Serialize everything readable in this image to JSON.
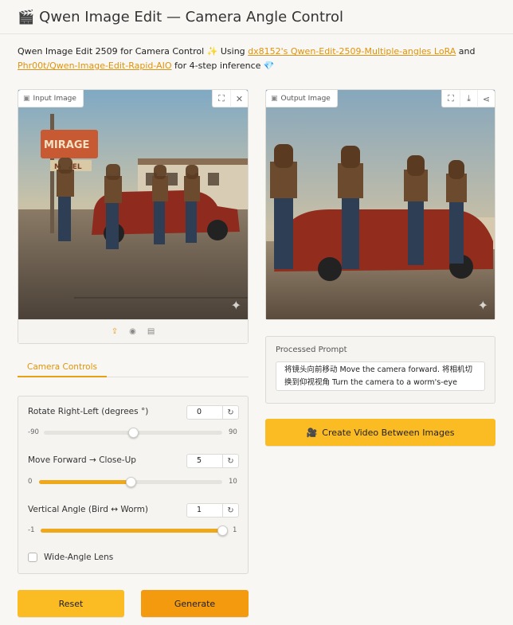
{
  "header": {
    "icon": "clapperboard-icon",
    "title": "Qwen Image Edit — Camera Angle Control"
  },
  "description": {
    "prefix": "Qwen Image Edit 2509 for Camera Control ✨ Using ",
    "link1": "dx8152's Qwen-Edit-2509-Multiple-angles LoRA",
    "middle": " and ",
    "link2": "Phr00t/Qwen-Image-Edit-Rapid-AIO",
    "suffix": " for 4-step inference 💎"
  },
  "input_image": {
    "label": "Input Image",
    "tools": [
      "fullscreen-icon",
      "close-icon"
    ],
    "source_icons": [
      "upload-icon",
      "webcam-icon",
      "clipboard-icon"
    ]
  },
  "output_image": {
    "label": "Output Image",
    "tools": [
      "fullscreen-icon",
      "download-icon",
      "share-icon"
    ]
  },
  "tabs": {
    "active": "Camera Controls"
  },
  "controls": {
    "rotate": {
      "label": "Rotate Right-Left (degrees °)",
      "value": "0",
      "min": "-90",
      "max": "90",
      "fraction": 0.5
    },
    "forward": {
      "label": "Move Forward → Close-Up",
      "value": "5",
      "min": "0",
      "max": "10",
      "fraction": 0.5
    },
    "vertical": {
      "label": "Vertical Angle (Bird ↔ Worm)",
      "value": "1",
      "min": "-1",
      "max": "1",
      "fraction": 1.0
    },
    "wide_angle": {
      "label": "Wide-Angle Lens",
      "checked": false
    }
  },
  "processed_prompt": {
    "label": "Processed Prompt",
    "text": "将镜头向前移动 Move the camera forward. 将相机切换到仰视视角 Turn the camera to a worm's-eye view."
  },
  "buttons": {
    "create_video": "Create Video Between Images",
    "reset": "Reset",
    "generate": "Generate"
  },
  "colors": {
    "accent": "#f0a81b",
    "primary_button": "#f39a0f",
    "secondary_button": "#fbbb22",
    "link": "#e0930d"
  }
}
